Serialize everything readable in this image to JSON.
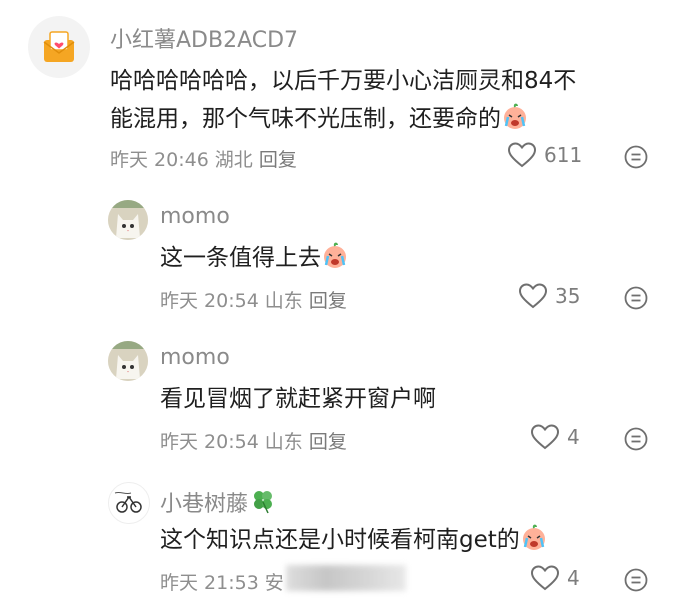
{
  "comments": [
    {
      "user": "小红薯ADB2ACD7",
      "text_line1": "哈哈哈哈哈哈，以后千万要小心洁厕灵和84不",
      "text_line2": "能混用，那个气味不光压制，还要命的",
      "time": "昨天 20:46",
      "location": "湖北",
      "reply_label": "回复",
      "likes": "611",
      "avatar_icon": "mail-heart-icon"
    },
    {
      "user": "momo",
      "text": "这一条值得上去",
      "time": "昨天 20:54",
      "location": "山东",
      "reply_label": "回复",
      "likes": "35",
      "avatar_icon": "cat-avatar-icon"
    },
    {
      "user": "momo",
      "text": "看见冒烟了就赶紧开窗户啊",
      "time": "昨天 20:54",
      "location": "山东",
      "reply_label": "回复",
      "likes": "4",
      "avatar_icon": "cat-avatar-icon"
    },
    {
      "user": "小巷树藤",
      "text": "这个知识点还是小时候看柯南get的",
      "time": "昨天 21:53",
      "location": "安",
      "likes": "4",
      "avatar_icon": "sketch-avatar-icon"
    }
  ],
  "colors": {
    "secondary_text": "#8e8e8e",
    "primary_text": "#1f1f1f",
    "icon_gray": "#6f6f6f"
  }
}
